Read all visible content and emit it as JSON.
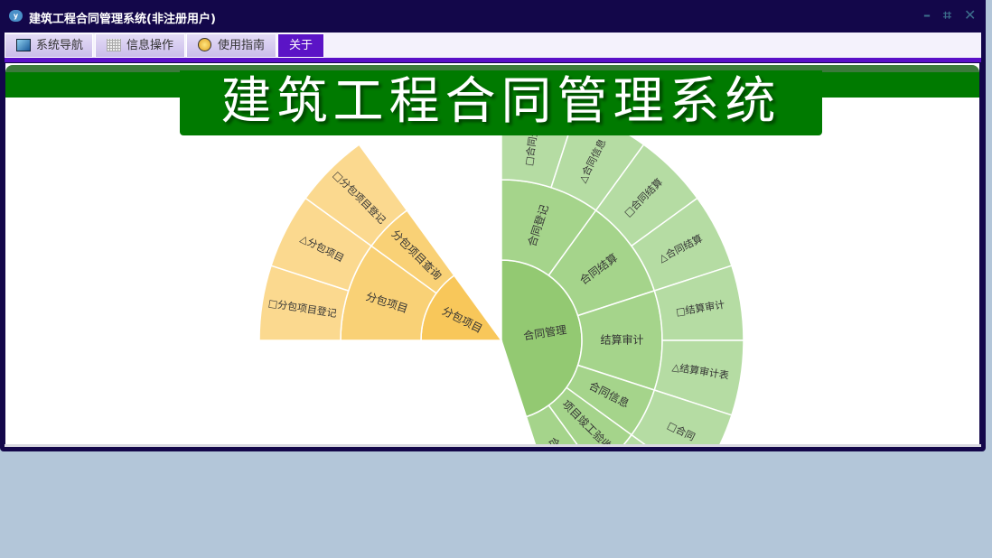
{
  "window": {
    "title": "建筑工程合同管理系统(非注册用户)",
    "logo_text": "y"
  },
  "controls": {
    "minimize": "–",
    "restore": "⌗",
    "close": "✕"
  },
  "tabs": [
    {
      "label": "系统导航",
      "icon": "monitor-icon"
    },
    {
      "label": "信息操作",
      "icon": "grid-icon"
    },
    {
      "label": "使用指南",
      "icon": "help-icon"
    },
    {
      "label": "关于",
      "active": true
    }
  ],
  "banner": {
    "title": "建筑工程合同管理系统"
  },
  "colors": {
    "green": [
      "#93c972",
      "#a5d48b",
      "#b5dca3"
    ],
    "orange": [
      "#f8c75a",
      "#f9d176",
      "#fbd98f"
    ]
  },
  "chart_data": {
    "type": "sunburst",
    "unit_degrees": 18,
    "nodes": [
      {
        "name": "合同管理",
        "palette": "green",
        "start": 90,
        "children": [
          {
            "name": "合同登记",
            "children": [
              {
                "name": "□合同登记",
                "value": 1
              },
              {
                "name": "△合同信息",
                "value": 1
              }
            ]
          },
          {
            "name": "合同结算",
            "children": [
              {
                "name": "□合同结算",
                "value": 1
              },
              {
                "name": "△合同结算",
                "value": 1
              }
            ]
          },
          {
            "name": "结算审计",
            "children": [
              {
                "name": "□结算审计",
                "value": 1
              },
              {
                "name": "△结算审计表",
                "value": 1
              }
            ]
          },
          {
            "name": "合同信息",
            "children": [
              {
                "name": "□合同",
                "value": 1
              }
            ]
          },
          {
            "name": "项目竣工验收",
            "children": [
              {
                "name": "",
                "value": 1
              }
            ]
          },
          {
            "name": "合同",
            "children": [
              {
                "name": "",
                "value": 1
              }
            ]
          }
        ]
      },
      {
        "name": "分包项目",
        "palette": "orange",
        "start": 180,
        "children": [
          {
            "name": "分包项目",
            "children": [
              {
                "name": "□分包项目登记",
                "value": 1
              },
              {
                "name": "△分包项目",
                "value": 1
              }
            ]
          },
          {
            "name": "分包项目查询",
            "children": [
              {
                "name": "□分包项目登记",
                "value": 1
              }
            ]
          }
        ]
      }
    ]
  }
}
